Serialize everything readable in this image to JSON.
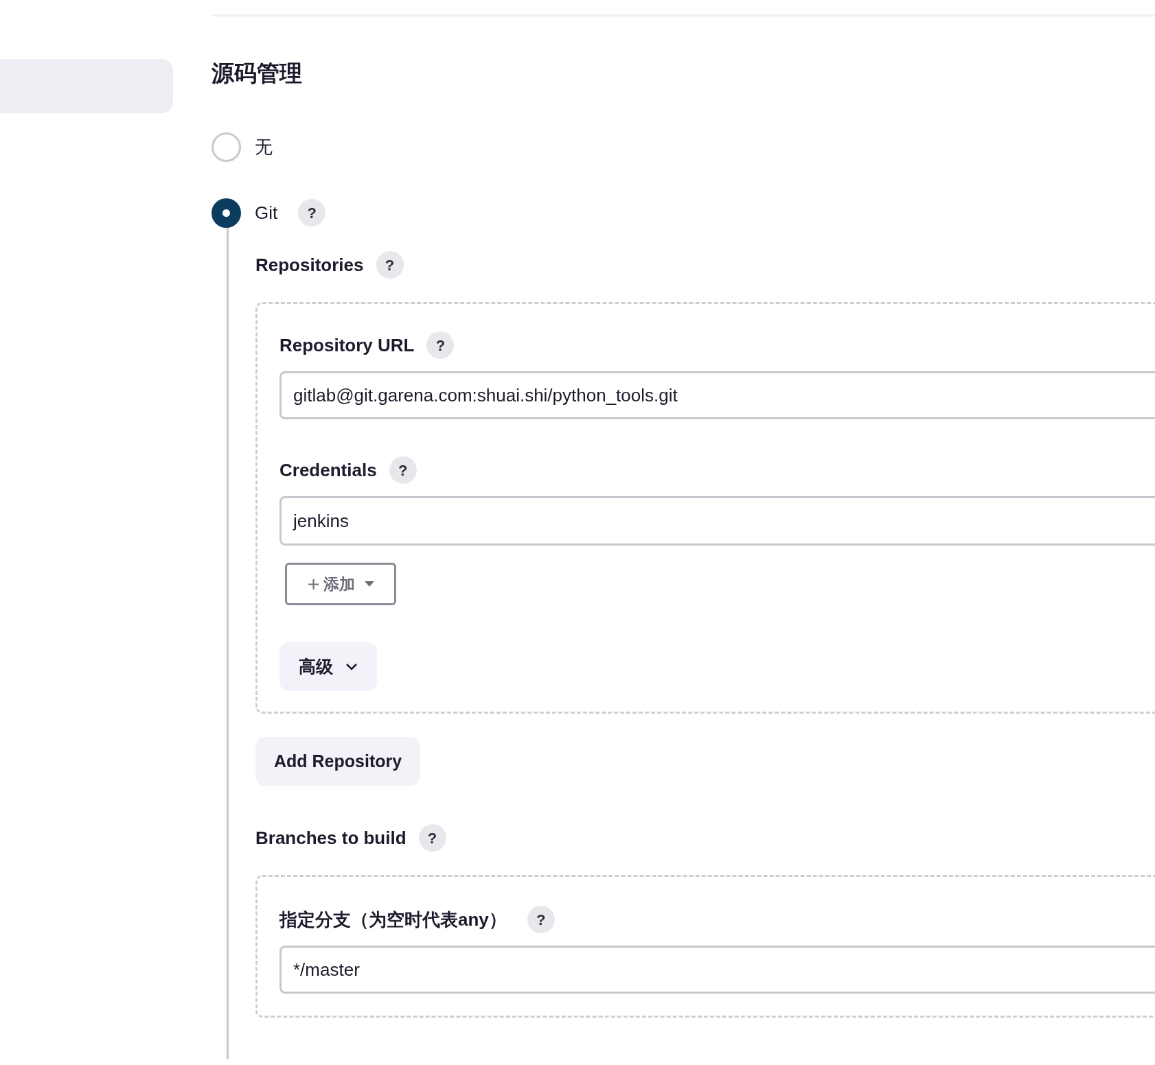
{
  "section": {
    "title": "源码管理"
  },
  "scm_options": [
    {
      "label": "无",
      "selected": false
    },
    {
      "label": "Git",
      "selected": true,
      "help": "?"
    }
  ],
  "git": {
    "repositories": {
      "label": "Repositories",
      "help": "?",
      "items": [
        {
          "url_label": "Repository URL",
          "url_help": "?",
          "url": "gitlab@git.garena.com:shuai.shi/python_tools.git",
          "credentials_label": "Credentials",
          "credentials_help": "?",
          "credentials": "jenkins",
          "add_button": "添加",
          "advanced_button": "高级"
        }
      ]
    },
    "add_repository_button": "Add Repository",
    "branches": {
      "label": "Branches to build",
      "help": "?",
      "items": [
        {
          "label": "指定分支（为空时代表any）",
          "help": "?",
          "value": "*/master"
        }
      ]
    }
  }
}
